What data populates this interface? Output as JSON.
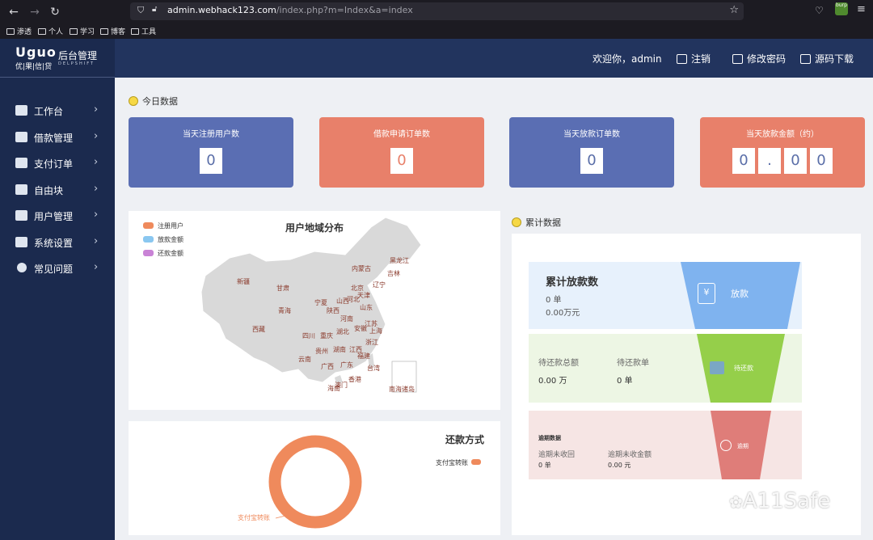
{
  "browser": {
    "url_host": "admin.webhack123.com",
    "url_path": "/index.php?m=Index&a=index",
    "bookmarks": [
      "渗透",
      "个人",
      "学习",
      "博客",
      "工具"
    ],
    "ext_label": "burp"
  },
  "logo": {
    "mark": "Uguo",
    "sub": "优|果|信|贷",
    "title": "后台管理",
    "en": "DELPSHIFT"
  },
  "sidebar": {
    "items": [
      {
        "label": "工作台",
        "icon": "monitor-icon"
      },
      {
        "label": "借款管理",
        "icon": "document-icon"
      },
      {
        "label": "支付订单",
        "icon": "card-icon"
      },
      {
        "label": "自由块",
        "icon": "grid-icon"
      },
      {
        "label": "用户管理",
        "icon": "user-icon"
      },
      {
        "label": "系统设置",
        "icon": "windows-icon"
      },
      {
        "label": "常见问题",
        "icon": "question-icon"
      }
    ]
  },
  "topbar": {
    "welcome": "欢迎你，admin",
    "logout": "注销",
    "change_password": "修改密码",
    "download": "源码下载"
  },
  "today": {
    "title": "今日数据",
    "cards": [
      {
        "label": "当天注册用户数",
        "digits": [
          "0"
        ],
        "color": "#5a6eb3"
      },
      {
        "label": "借款申请订单数",
        "digits": [
          "0"
        ],
        "color": "#e8806a"
      },
      {
        "label": "当天放款订单数",
        "digits": [
          "0"
        ],
        "color": "#5a6eb3"
      },
      {
        "label": "当天放款金额（约）",
        "digits": [
          "0",
          ".",
          "0",
          "0"
        ],
        "color": "#e8806a"
      }
    ]
  },
  "map": {
    "title": "用户地域分布",
    "legend": [
      {
        "label": "注册用户",
        "color": "#ef8a5c"
      },
      {
        "label": "放款金额",
        "color": "#8ac7f0"
      },
      {
        "label": "还款金额",
        "color": "#c983d6"
      }
    ],
    "provinces": [
      "黑龙江",
      "吉林",
      "内蒙古",
      "辽宁",
      "北京",
      "天津",
      "河北",
      "山西",
      "山东",
      "新疆",
      "甘肃",
      "宁夏",
      "青海",
      "陕西",
      "河南",
      "江苏",
      "安徽",
      "上海",
      "西藏",
      "四川",
      "重庆",
      "湖北",
      "浙江",
      "贵州",
      "湖南",
      "江西",
      "福建",
      "云南",
      "广西",
      "广东",
      "台湾",
      "香港",
      "澳门",
      "海南",
      "南海诸岛"
    ]
  },
  "repay": {
    "title": "还款方式",
    "legend_label": "支付宝转账",
    "slice_label": "支付宝转账",
    "color": "#ef8a5c"
  },
  "cumulative": {
    "title": "累计数据",
    "loan": {
      "heading": "累计放款数",
      "count": "0 单",
      "amount": "0.00万元",
      "badge": "放款",
      "glyph": "¥"
    },
    "pending": {
      "col1_label": "待还款总额",
      "col1_value": "0.00 万",
      "col2_label": "待还款单",
      "col2_value": "0 单",
      "badge": "待还款"
    },
    "overdue": {
      "heading": "逾期数据",
      "col1_label": "逾期未收回",
      "col1_value": "0 单",
      "col2_label": "逾期未收金额",
      "col2_value": "0.00 元",
      "badge": "逾期"
    }
  },
  "watermark": "A11Safe"
}
